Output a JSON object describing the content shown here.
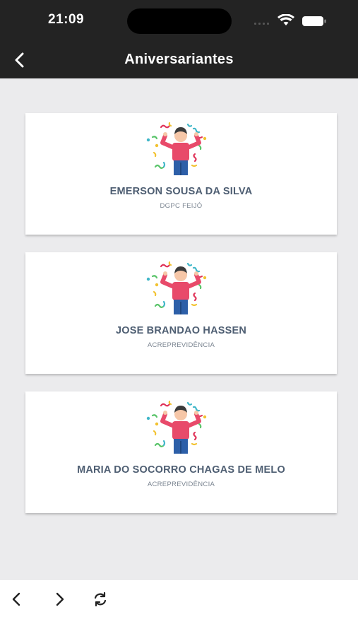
{
  "status": {
    "time": "21:09"
  },
  "header": {
    "title": "Aniversariantes"
  },
  "cards": [
    {
      "name": "EMERSON SOUSA DA SILVA",
      "dept": "DGPC FEIJÓ"
    },
    {
      "name": "JOSE BRANDAO HASSEN",
      "dept": "ACREPREVIDÊNCIA"
    },
    {
      "name": "MARIA DO SOCORRO CHAGAS DE MELO",
      "dept": "ACREPREVIDÊNCIA"
    }
  ],
  "icons": {
    "back": "chevron-left-icon",
    "prev": "chevron-left-icon",
    "next": "chevron-right-icon",
    "reload": "reload-icon",
    "avatar": "party-person-icon"
  },
  "colors": {
    "header": "#232323",
    "background": "#ebebed",
    "name": "#4e5e72",
    "dept": "#7b8591"
  }
}
